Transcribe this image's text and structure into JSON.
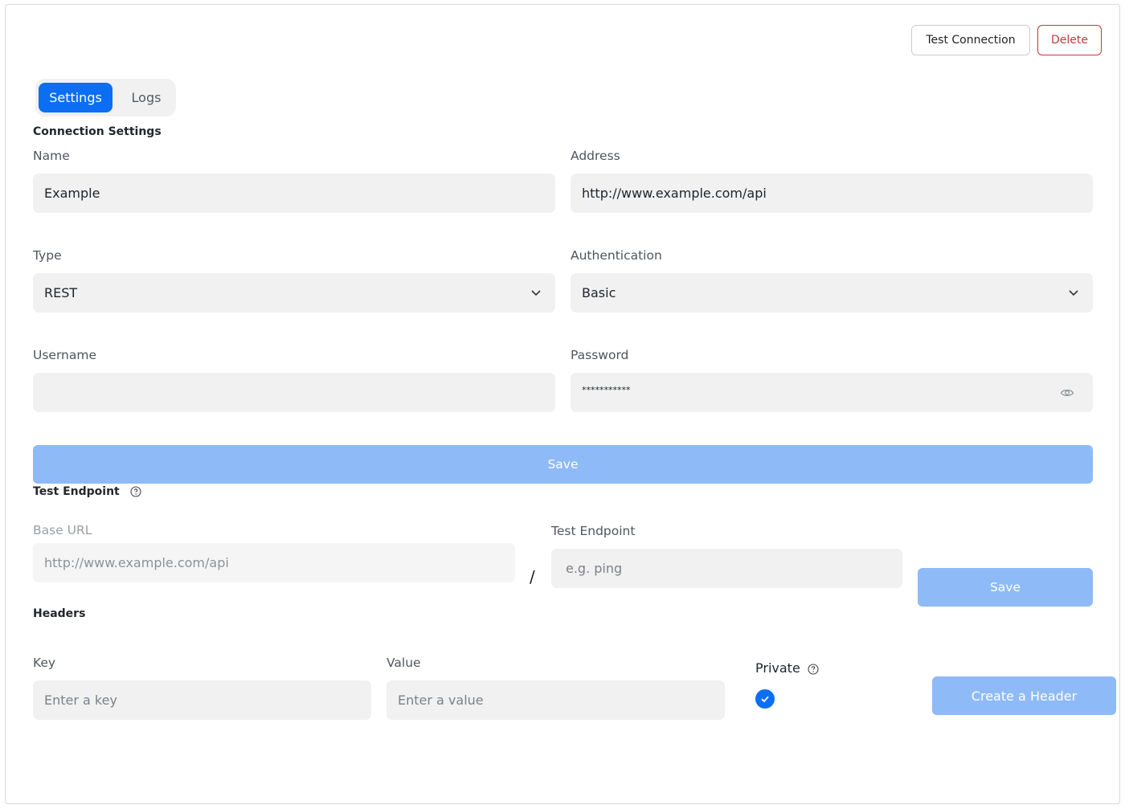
{
  "header": {
    "test_connection_label": "Test Connection",
    "delete_label": "Delete"
  },
  "tabs": [
    {
      "label": "Settings",
      "active": true
    },
    {
      "label": "Logs",
      "active": false
    }
  ],
  "connection": {
    "title": "Connection Settings",
    "name": {
      "label": "Name",
      "value": "Example"
    },
    "address": {
      "label": "Address",
      "value": "http://www.example.com/api"
    },
    "type": {
      "label": "Type",
      "value": "REST"
    },
    "authentication": {
      "label": "Authentication",
      "value": "Basic"
    },
    "username": {
      "label": "Username",
      "value": ""
    },
    "password": {
      "label": "Password",
      "value": "***********"
    },
    "save_label": "Save"
  },
  "test_endpoint": {
    "title": "Test Endpoint",
    "base_url": {
      "label": "Base URL",
      "value": "http://www.example.com/api"
    },
    "separator": "/",
    "endpoint": {
      "label": "Test Endpoint",
      "placeholder": "e.g. ping"
    },
    "save_label": "Save"
  },
  "headers": {
    "title": "Headers",
    "key": {
      "label": "Key",
      "placeholder": "Enter a key"
    },
    "value": {
      "label": "Value",
      "placeholder": "Enter a value"
    },
    "private": {
      "label": "Private",
      "checked": true
    },
    "create_label": "Create a Header"
  },
  "colors": {
    "primary": "#0b6ef3",
    "primary_disabled": "#8ebaf8",
    "danger": "#c0393b",
    "field_bg": "#f1f1f2"
  }
}
